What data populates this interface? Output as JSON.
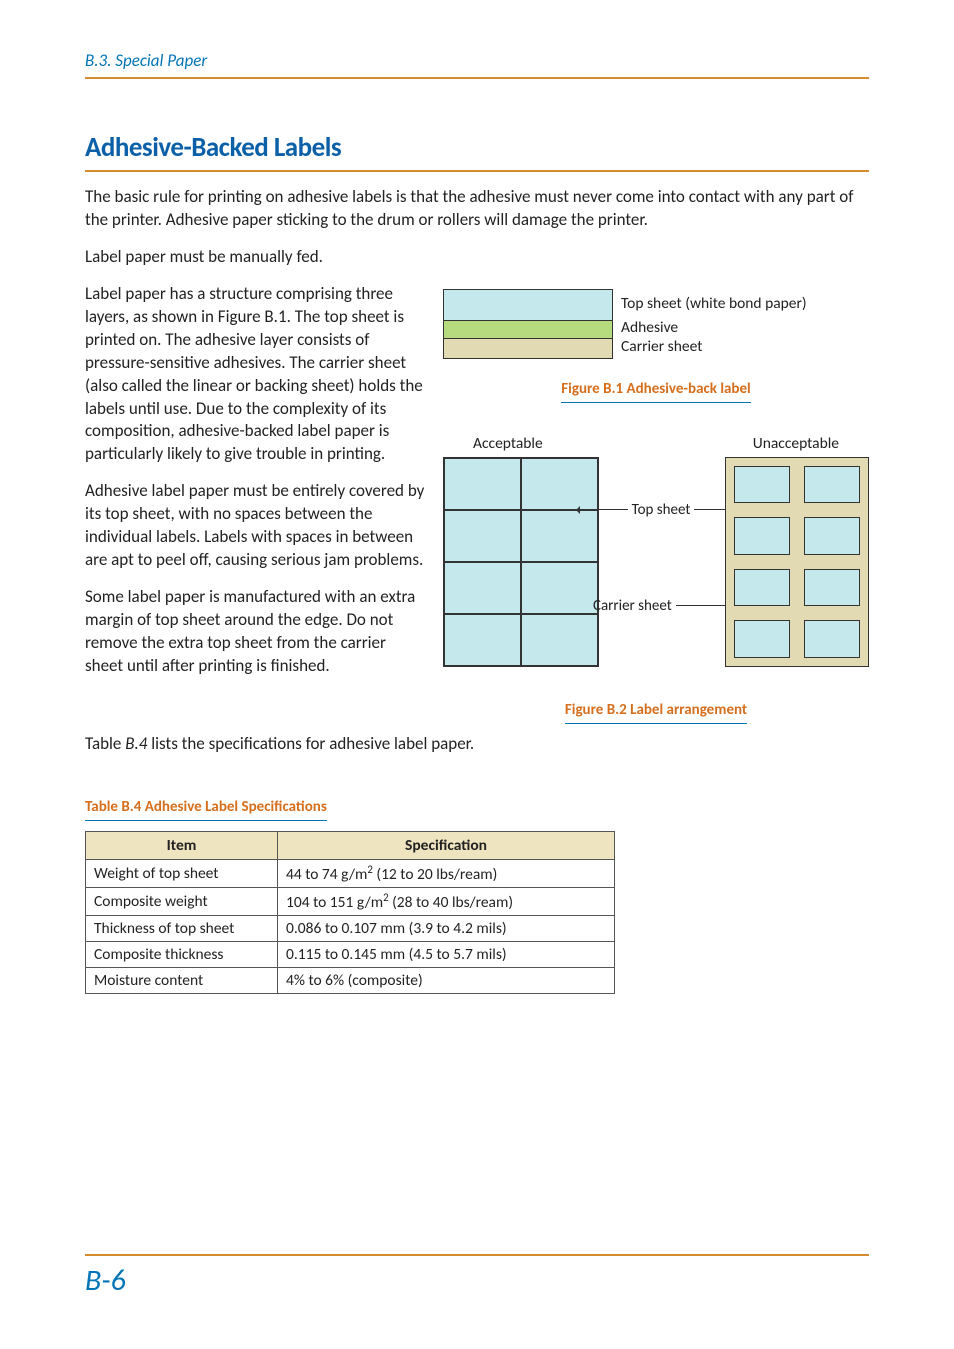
{
  "section_header": "B.3.  Special Paper",
  "heading": "Adhesive-Backed Labels",
  "para1": "The basic rule for printing on adhesive labels is that the adhesive must never come into contact with any part of the printer. Adhesive paper sticking to the drum or rollers will damage the printer.",
  "para2": "Label paper must be manually fed.",
  "para3": "Label paper has a structure comprising three layers, as shown in Figure B.1. The top sheet is printed on. The adhesive layer consists of pressure-sensitive adhesives. The carrier sheet (also called the linear or backing sheet) holds the labels until use. Due to the complexity of its composition, adhesive-backed label paper is particularly likely to give trouble in printing.",
  "para4": "Adhesive label paper must be entirely covered by its top sheet, with no spaces between the individual labels. Labels with spaces in between are apt to peel off, causing serious jam problems.",
  "para5": "Some label paper is manufactured with an extra margin of top sheet around the edge. Do not remove the extra top sheet from the carrier sheet until after printing is finished.",
  "para6_prefix": "Table ",
  "para6_em": "B.4",
  "para6_suffix": " lists the specifications for adhesive label paper.",
  "fig1": {
    "layers": {
      "top": "Top sheet (white bond paper)",
      "adhesive": "Adhesive",
      "carrier": "Carrier sheet"
    },
    "caption": "Figure B.1 Adhesive-back label"
  },
  "fig2": {
    "acceptable": "Acceptable",
    "unacceptable": "Unacceptable",
    "top_sheet": "Top sheet",
    "carrier_sheet": "Carrier sheet",
    "caption": "Figure B.2 Label arrangement"
  },
  "table": {
    "caption": "Table B.4  Adhesive Label Specifications",
    "headers": {
      "item": "Item",
      "spec": "Specification"
    },
    "rows": [
      {
        "item": "Weight of top sheet",
        "spec_pre": "44 to 74 g/m",
        "spec_sup": "2",
        "spec_post": " (12 to 20 lbs/ream)"
      },
      {
        "item": "Composite weight",
        "spec_pre": "104 to 151 g/m",
        "spec_sup": "2",
        "spec_post": " (28 to 40 lbs/ream)"
      },
      {
        "item": "Thickness of top sheet",
        "spec_pre": "0.086 to 0.107 mm (3.9 to 4.2 mils)",
        "spec_sup": "",
        "spec_post": ""
      },
      {
        "item": "Composite thickness",
        "spec_pre": "0.115 to 0.145 mm (4.5 to 5.7 mils)",
        "spec_sup": "",
        "spec_post": ""
      },
      {
        "item": "Moisture content",
        "spec_pre": "4% to 6% (composite)",
        "spec_sup": "",
        "spec_post": ""
      }
    ]
  },
  "page_number": "B-6"
}
